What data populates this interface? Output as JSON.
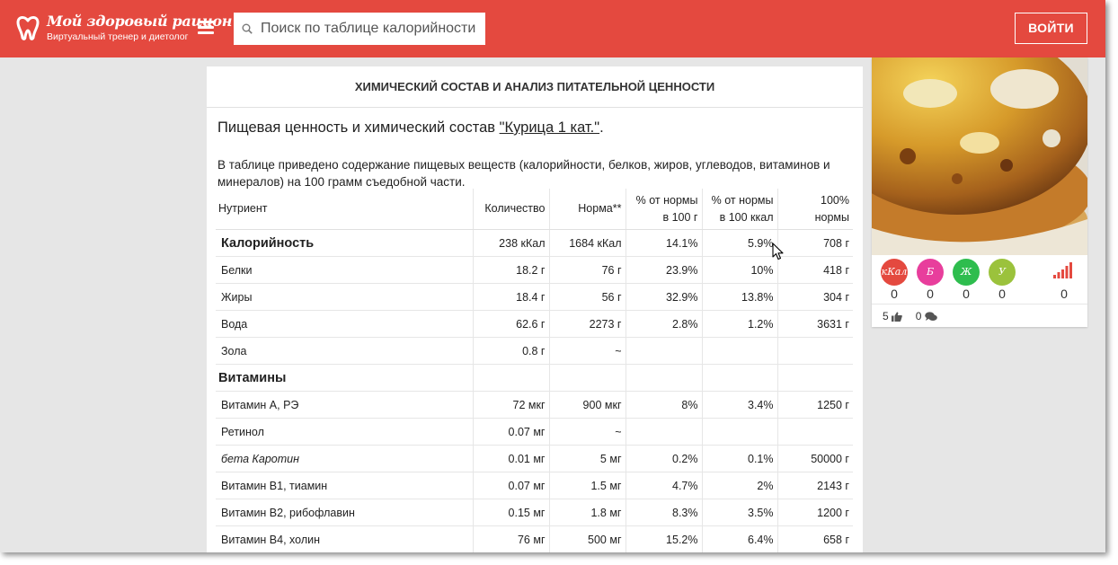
{
  "header": {
    "logo_name": "Мой здоровый рацион",
    "logo_tagline": "Виртуальный тренер и диетолог",
    "search_placeholder": "Поиск по таблице калорийности",
    "login_label": "ВОЙТИ",
    "brand_color": "#e4493f"
  },
  "card": {
    "title": "ХИМИЧЕСКИЙ СОСТАВ И АНАЛИЗ ПИТАТЕЛЬНОЙ ЦЕННОСТИ",
    "intro_prefix": "Пищевая ценность и химический состав ",
    "product_link": "\"Курица 1 кат.\"",
    "intro_suffix": ".",
    "description": "В таблице приведено содержание пищевых веществ (калорийности, белков, жиров, углеводов, витаминов и минералов) на 100 грамм съедобной части."
  },
  "table": {
    "columns": [
      "Нутриент",
      "Количество",
      "Норма**",
      "% от нормы в 100 г",
      "% от нормы в 100 ккал",
      "100% нормы"
    ],
    "rows": [
      {
        "style": "bold",
        "cells": [
          "Калорийность",
          "238 кКал",
          "1684 кКал",
          "14.1%",
          "5.9%",
          "708 г"
        ]
      },
      {
        "style": "",
        "cells": [
          "Белки",
          "18.2 г",
          "76 г",
          "23.9%",
          "10%",
          "418 г"
        ]
      },
      {
        "style": "",
        "cells": [
          "Жиры",
          "18.4 г",
          "56 г",
          "32.9%",
          "13.8%",
          "304 г"
        ]
      },
      {
        "style": "",
        "cells": [
          "Вода",
          "62.6 г",
          "2273 г",
          "2.8%",
          "1.2%",
          "3631 г"
        ]
      },
      {
        "style": "",
        "cells": [
          "Зола",
          "0.8 г",
          "~",
          "",
          "",
          ""
        ]
      },
      {
        "style": "section",
        "cells": [
          "Витамины",
          "",
          "",
          "",
          "",
          ""
        ]
      },
      {
        "style": "",
        "cells": [
          "Витамин А, РЭ",
          "72 мкг",
          "900 мкг",
          "8%",
          "3.4%",
          "1250 г"
        ]
      },
      {
        "style": "",
        "cells": [
          "Ретинол",
          "0.07 мг",
          "~",
          "",
          "",
          ""
        ]
      },
      {
        "style": "italic",
        "cells": [
          "бета Каротин",
          "0.01 мг",
          "5 мг",
          "0.2%",
          "0.1%",
          "50000 г"
        ]
      },
      {
        "style": "",
        "cells": [
          "Витамин В1, тиамин",
          "0.07 мг",
          "1.5 мг",
          "4.7%",
          "2%",
          "2143 г"
        ]
      },
      {
        "style": "",
        "cells": [
          "Витамин В2, рибофлавин",
          "0.15 мг",
          "1.8 мг",
          "8.3%",
          "3.5%",
          "1200 г"
        ]
      },
      {
        "style": "",
        "cells": [
          "Витамин В4, холин",
          "76 мг",
          "500 мг",
          "15.2%",
          "6.4%",
          "658 г"
        ]
      }
    ]
  },
  "side": {
    "badges": [
      {
        "label": "кКал",
        "count": "0",
        "color": "#e4493f"
      },
      {
        "label": "Б",
        "count": "0",
        "color": "#e83e9c"
      },
      {
        "label": "Ж",
        "count": "0",
        "color": "#2ebd4e"
      },
      {
        "label": "У",
        "count": "0",
        "color": "#9bc23c"
      }
    ],
    "signal_count": "0",
    "likes": "5",
    "comments": "0"
  }
}
